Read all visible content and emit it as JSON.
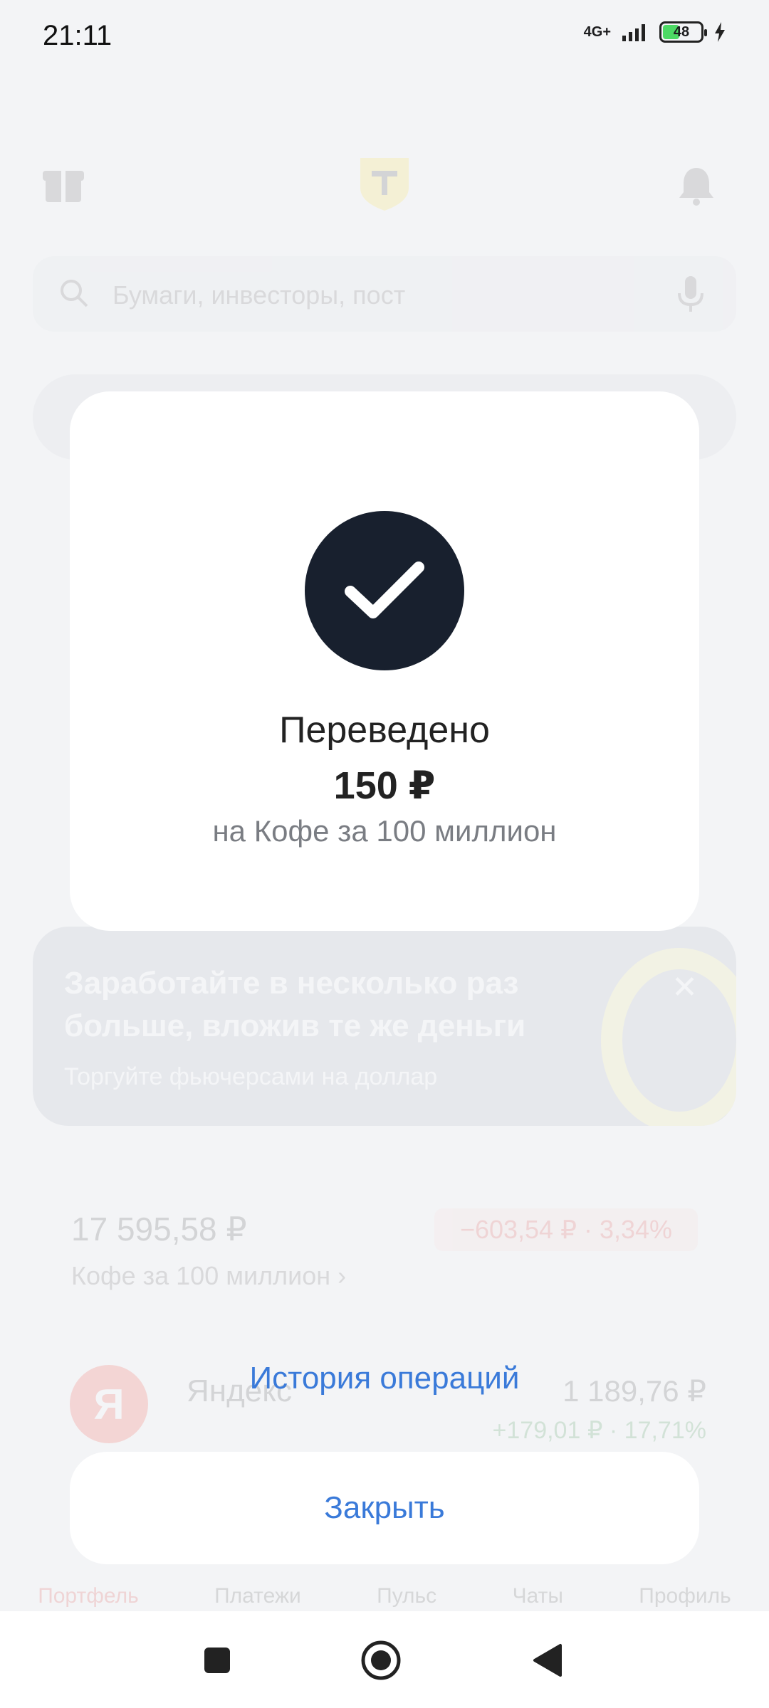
{
  "status_bar": {
    "time": "21:11",
    "network": "4G+",
    "battery": "48",
    "battery_level": 0.48
  },
  "background": {
    "search_placeholder": "Бумаги, инвесторы, пост",
    "promo": {
      "title": "Заработайте в несколько раз больше, вложив те же деньги",
      "subtitle": "Торгуйте фьючерсами на доллар"
    },
    "portfolio": {
      "amount": "17 595,58 ₽",
      "change": "−603,54 ₽ · 3,34%",
      "name": "Кофе за 100 миллион ›"
    },
    "asset": {
      "logo_letter": "Я",
      "name": "Яндекс",
      "value": "1 189,76 ₽",
      "delta": "+179,01 ₽ · 17,71%"
    },
    "bottom_nav": [
      "Портфель",
      "Платежи",
      "Пульс",
      "Чаты",
      "Профиль"
    ]
  },
  "dialog": {
    "title": "Переведено",
    "amount": "150 ₽",
    "recipient": "на Кофе за 100 миллион"
  },
  "history_link": "История операций",
  "close_button": "Закрыть",
  "colors": {
    "accent": "#3a7ad9",
    "icon_circle": "#18202e",
    "loss": "#e03131"
  },
  "icons": [
    "check-icon",
    "gift-icon",
    "logo-icon",
    "bell-icon",
    "search-icon",
    "mic-icon",
    "recents-icon",
    "home-icon",
    "back-icon"
  ]
}
